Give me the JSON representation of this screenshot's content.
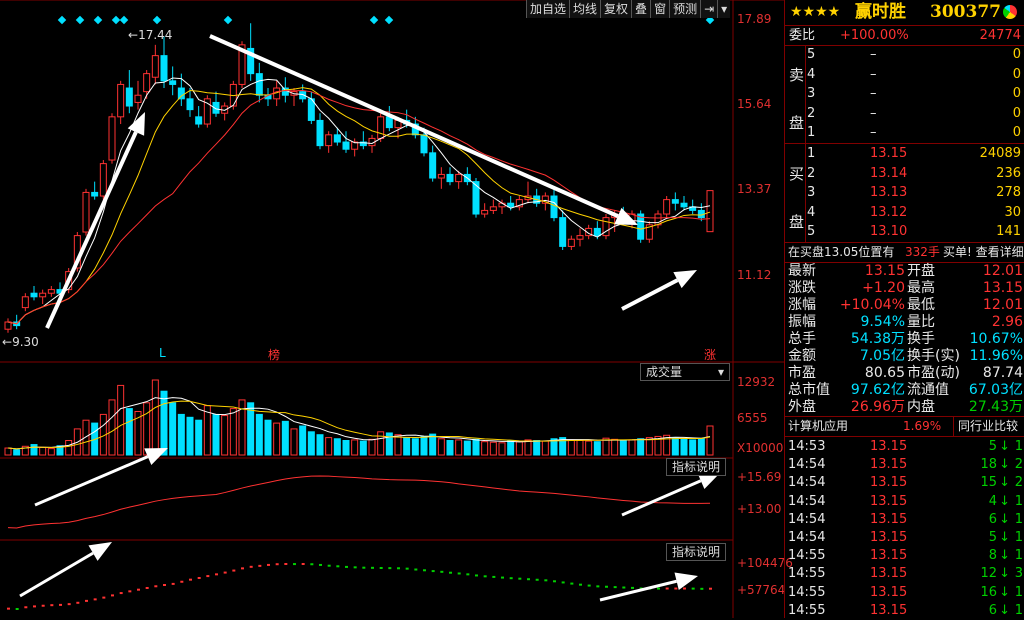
{
  "toolbar": {
    "add_watchlist": "加自选",
    "ma_line": "均线",
    "adjust": "复权",
    "overlay": "叠",
    "window": "窗",
    "forecast": "预测",
    "more": "▾"
  },
  "price_axis": {
    "top": "17.89",
    "mid1": "15.64",
    "mid2": "13.37",
    "bottom": "11.12"
  },
  "annotations": {
    "high": "17.44",
    "low": "9.30",
    "mark_l": "L",
    "mark_bang": "榜",
    "mark_zhang": "涨"
  },
  "volume_panel": {
    "button": "成交量",
    "axis_top": "12932",
    "axis_mid": "6555",
    "axis_unit": "X10000"
  },
  "indicator1": {
    "button": "指标说明",
    "axis_top": "+15.69",
    "axis_mid": "+13.00"
  },
  "indicator2": {
    "button": "指标说明",
    "axis_top": "+104476",
    "axis_mid": "+57764"
  },
  "stock": {
    "name": "赢时胜",
    "code": "300377",
    "stars": "★★★★"
  },
  "commission": {
    "label": "委比",
    "ratio": "+100.00%",
    "diff": "24774"
  },
  "sell_label": [
    "卖",
    "盘"
  ],
  "buy_label": [
    "买",
    "盘"
  ],
  "sell_orders": [
    {
      "level": "5",
      "price": "–",
      "qty": "0"
    },
    {
      "level": "4",
      "price": "–",
      "qty": "0"
    },
    {
      "level": "3",
      "price": "–",
      "qty": "0"
    },
    {
      "level": "2",
      "price": "–",
      "qty": "0"
    },
    {
      "level": "1",
      "price": "–",
      "qty": "0"
    }
  ],
  "buy_orders": [
    {
      "level": "1",
      "price": "13.15",
      "qty": "24089"
    },
    {
      "level": "2",
      "price": "13.14",
      "qty": "236"
    },
    {
      "level": "3",
      "price": "13.13",
      "qty": "278"
    },
    {
      "level": "4",
      "price": "13.12",
      "qty": "30"
    },
    {
      "level": "5",
      "price": "13.10",
      "qty": "141"
    }
  ],
  "notice": {
    "text": "在买盘13.05位置有",
    "qty": "332手",
    "action": "买单! 查看详细"
  },
  "stats": [
    {
      "l1": "最新",
      "v1": "13.15",
      "c1": "red",
      "l2": "开盘",
      "v2": "12.01",
      "c2": "red"
    },
    {
      "l1": "涨跌",
      "v1": "+1.20",
      "c1": "red",
      "l2": "最高",
      "v2": "13.15",
      "c2": "red"
    },
    {
      "l1": "涨幅",
      "v1": "+10.04%",
      "c1": "red",
      "l2": "最低",
      "v2": "12.01",
      "c2": "red"
    },
    {
      "l1": "振幅",
      "v1": "9.54%",
      "c1": "cyan",
      "l2": "量比",
      "v2": "2.96",
      "c2": "red"
    },
    {
      "l1": "总手",
      "v1": "54.38万",
      "c1": "cyan",
      "l2": "换手",
      "v2": "10.67%",
      "c2": "cyan"
    },
    {
      "l1": "金额",
      "v1": "7.05亿",
      "c1": "cyan",
      "l2": "换手(实)",
      "v2": "11.96%",
      "c2": "cyan"
    },
    {
      "l1": "市盈",
      "v1": "80.65",
      "c1": "white",
      "l2": "市盈(动)",
      "v2": "87.74",
      "c2": "white"
    },
    {
      "l1": "总市值",
      "v1": "97.62亿",
      "c1": "cyan",
      "l2": "流通值",
      "v2": "67.03亿",
      "c2": "cyan"
    },
    {
      "l1": "外盘",
      "v1": "26.96万",
      "c1": "red",
      "l2": "内盘",
      "v2": "27.43万",
      "c2": "green"
    }
  ],
  "industry": {
    "name": "计算机应用",
    "change": "1.69%",
    "compare": "同行业比较"
  },
  "ticks": [
    {
      "time": "14:53",
      "price": "13.15",
      "vol": "5",
      "n": "1"
    },
    {
      "time": "14:54",
      "price": "13.15",
      "vol": "18",
      "n": "2"
    },
    {
      "time": "14:54",
      "price": "13.15",
      "vol": "15",
      "n": "2"
    },
    {
      "time": "14:54",
      "price": "13.15",
      "vol": "4",
      "n": "1"
    },
    {
      "time": "14:54",
      "price": "13.15",
      "vol": "6",
      "n": "1"
    },
    {
      "time": "14:54",
      "price": "13.15",
      "vol": "5",
      "n": "1"
    },
    {
      "time": "14:55",
      "price": "13.15",
      "vol": "8",
      "n": "1"
    },
    {
      "time": "14:55",
      "price": "13.15",
      "vol": "12",
      "n": "3"
    },
    {
      "time": "14:55",
      "price": "13.15",
      "vol": "16",
      "n": "1"
    },
    {
      "time": "14:55",
      "price": "13.15",
      "vol": "6",
      "n": "1"
    }
  ],
  "colors": {
    "up": "#ff3232",
    "down": "#00e0ff",
    "border": "#800000",
    "ma5": "#ffffff",
    "ma10": "#ffd200",
    "ma20": "#ff3232"
  },
  "chart_data": {
    "type": "candlestick",
    "ylim": [
      9.0,
      17.89
    ],
    "candles": [
      [
        9.3,
        9.6,
        9.2,
        9.5
      ],
      [
        9.5,
        9.7,
        9.3,
        9.4
      ],
      [
        9.9,
        10.3,
        9.8,
        10.2
      ],
      [
        10.3,
        10.5,
        10.1,
        10.2
      ],
      [
        10.2,
        10.4,
        10.0,
        10.3
      ],
      [
        10.3,
        10.5,
        10.2,
        10.4
      ],
      [
        10.4,
        10.6,
        10.2,
        10.3
      ],
      [
        10.4,
        11.0,
        10.3,
        10.9
      ],
      [
        11.0,
        12.0,
        10.9,
        11.9
      ],
      [
        12.0,
        13.2,
        11.9,
        13.1
      ],
      [
        13.1,
        13.4,
        12.9,
        13.0
      ],
      [
        13.0,
        14.0,
        12.9,
        13.9
      ],
      [
        14.0,
        15.3,
        13.9,
        15.2
      ],
      [
        15.2,
        16.2,
        15.0,
        16.1
      ],
      [
        16.0,
        16.5,
        15.3,
        15.5
      ],
      [
        15.6,
        16.2,
        15.4,
        15.8
      ],
      [
        15.9,
        16.5,
        15.7,
        16.4
      ],
      [
        16.3,
        17.2,
        16.1,
        16.9
      ],
      [
        16.9,
        17.44,
        16.0,
        16.2
      ],
      [
        16.2,
        16.6,
        15.8,
        16.1
      ],
      [
        16.0,
        16.4,
        15.5,
        15.7
      ],
      [
        15.7,
        16.0,
        15.2,
        15.4
      ],
      [
        15.2,
        15.5,
        14.9,
        15.0
      ],
      [
        15.0,
        15.8,
        14.9,
        15.7
      ],
      [
        15.6,
        15.9,
        15.2,
        15.3
      ],
      [
        15.3,
        15.6,
        15.1,
        15.5
      ],
      [
        15.5,
        16.2,
        15.4,
        16.1
      ],
      [
        16.1,
        17.3,
        16.0,
        17.2
      ],
      [
        17.1,
        17.8,
        16.2,
        16.4
      ],
      [
        16.4,
        16.7,
        15.6,
        15.8
      ],
      [
        15.8,
        16.0,
        15.5,
        15.7
      ],
      [
        15.7,
        16.2,
        15.5,
        16.0
      ],
      [
        16.0,
        16.3,
        15.6,
        15.8
      ],
      [
        15.8,
        16.0,
        15.5,
        15.9
      ],
      [
        15.9,
        16.1,
        15.6,
        15.7
      ],
      [
        15.7,
        15.9,
        15.0,
        15.1
      ],
      [
        15.1,
        15.3,
        14.3,
        14.4
      ],
      [
        14.4,
        14.8,
        14.2,
        14.7
      ],
      [
        14.7,
        14.9,
        14.4,
        14.5
      ],
      [
        14.5,
        14.8,
        14.2,
        14.3
      ],
      [
        14.3,
        14.6,
        14.1,
        14.5
      ],
      [
        14.5,
        14.8,
        14.3,
        14.4
      ],
      [
        14.4,
        14.7,
        14.2,
        14.6
      ],
      [
        14.6,
        15.3,
        14.5,
        15.2
      ],
      [
        15.2,
        15.5,
        14.8,
        14.9
      ],
      [
        14.9,
        15.2,
        14.6,
        15.1
      ],
      [
        15.1,
        15.4,
        14.9,
        15.0
      ],
      [
        15.0,
        15.2,
        14.6,
        14.7
      ],
      [
        14.7,
        14.9,
        14.1,
        14.2
      ],
      [
        14.2,
        14.4,
        13.4,
        13.5
      ],
      [
        13.5,
        13.8,
        13.2,
        13.6
      ],
      [
        13.6,
        13.8,
        13.3,
        13.4
      ],
      [
        13.4,
        13.7,
        13.2,
        13.6
      ],
      [
        13.6,
        13.8,
        13.3,
        13.4
      ],
      [
        13.4,
        13.5,
        12.4,
        12.5
      ],
      [
        12.5,
        12.8,
        12.4,
        12.6
      ],
      [
        12.6,
        12.9,
        12.5,
        12.7
      ],
      [
        12.7,
        12.9,
        12.5,
        12.8
      ],
      [
        12.8,
        13.0,
        12.6,
        12.7
      ],
      [
        12.7,
        13.0,
        12.6,
        12.9
      ],
      [
        12.9,
        13.4,
        12.8,
        13.0
      ],
      [
        13.0,
        13.2,
        12.7,
        12.8
      ],
      [
        12.8,
        13.1,
        12.6,
        13.0
      ],
      [
        13.0,
        13.2,
        12.3,
        12.4
      ],
      [
        12.4,
        12.6,
        11.5,
        11.6
      ],
      [
        11.6,
        11.9,
        11.5,
        11.8
      ],
      [
        11.8,
        12.1,
        11.6,
        11.9
      ],
      [
        11.9,
        12.2,
        11.8,
        12.1
      ],
      [
        12.1,
        12.3,
        11.8,
        11.9
      ],
      [
        11.9,
        12.5,
        11.8,
        12.4
      ],
      [
        12.4,
        12.6,
        12.0,
        12.5
      ],
      [
        12.5,
        12.7,
        12.2,
        12.3
      ],
      [
        12.3,
        12.6,
        12.1,
        12.5
      ],
      [
        12.5,
        12.6,
        11.7,
        11.8
      ],
      [
        11.8,
        12.3,
        11.7,
        12.2
      ],
      [
        12.2,
        12.6,
        12.1,
        12.5
      ],
      [
        12.5,
        13.0,
        12.4,
        12.9
      ],
      [
        12.9,
        13.1,
        12.6,
        12.8
      ],
      [
        12.8,
        13.0,
        12.6,
        12.7
      ],
      [
        12.7,
        12.9,
        12.5,
        12.6
      ],
      [
        12.6,
        12.8,
        12.3,
        12.4
      ],
      [
        12.01,
        13.15,
        12.01,
        13.15
      ]
    ],
    "volume": [
      1200,
      900,
      1500,
      1800,
      1300,
      1100,
      1600,
      2500,
      4500,
      6000,
      5500,
      7000,
      9500,
      12000,
      8000,
      7500,
      9000,
      12932,
      11000,
      9000,
      7000,
      6500,
      6000,
      8500,
      7000,
      6800,
      8000,
      9500,
      9000,
      7000,
      6000,
      5500,
      5800,
      4500,
      5000,
      4000,
      3500,
      3000,
      2800,
      2500,
      2600,
      2400,
      2700,
      4000,
      3800,
      3500,
      3000,
      2800,
      3200,
      3600,
      2800,
      2500,
      2600,
      2400,
      2700,
      2300,
      2200,
      2100,
      2400,
      2300,
      2600,
      2500,
      2400,
      2800,
      3000,
      2600,
      2500,
      2400,
      2300,
      2900,
      2700,
      2500,
      2600,
      2800,
      3000,
      3200,
      3400,
      2900,
      2700,
      2600,
      2800,
      5000
    ]
  }
}
